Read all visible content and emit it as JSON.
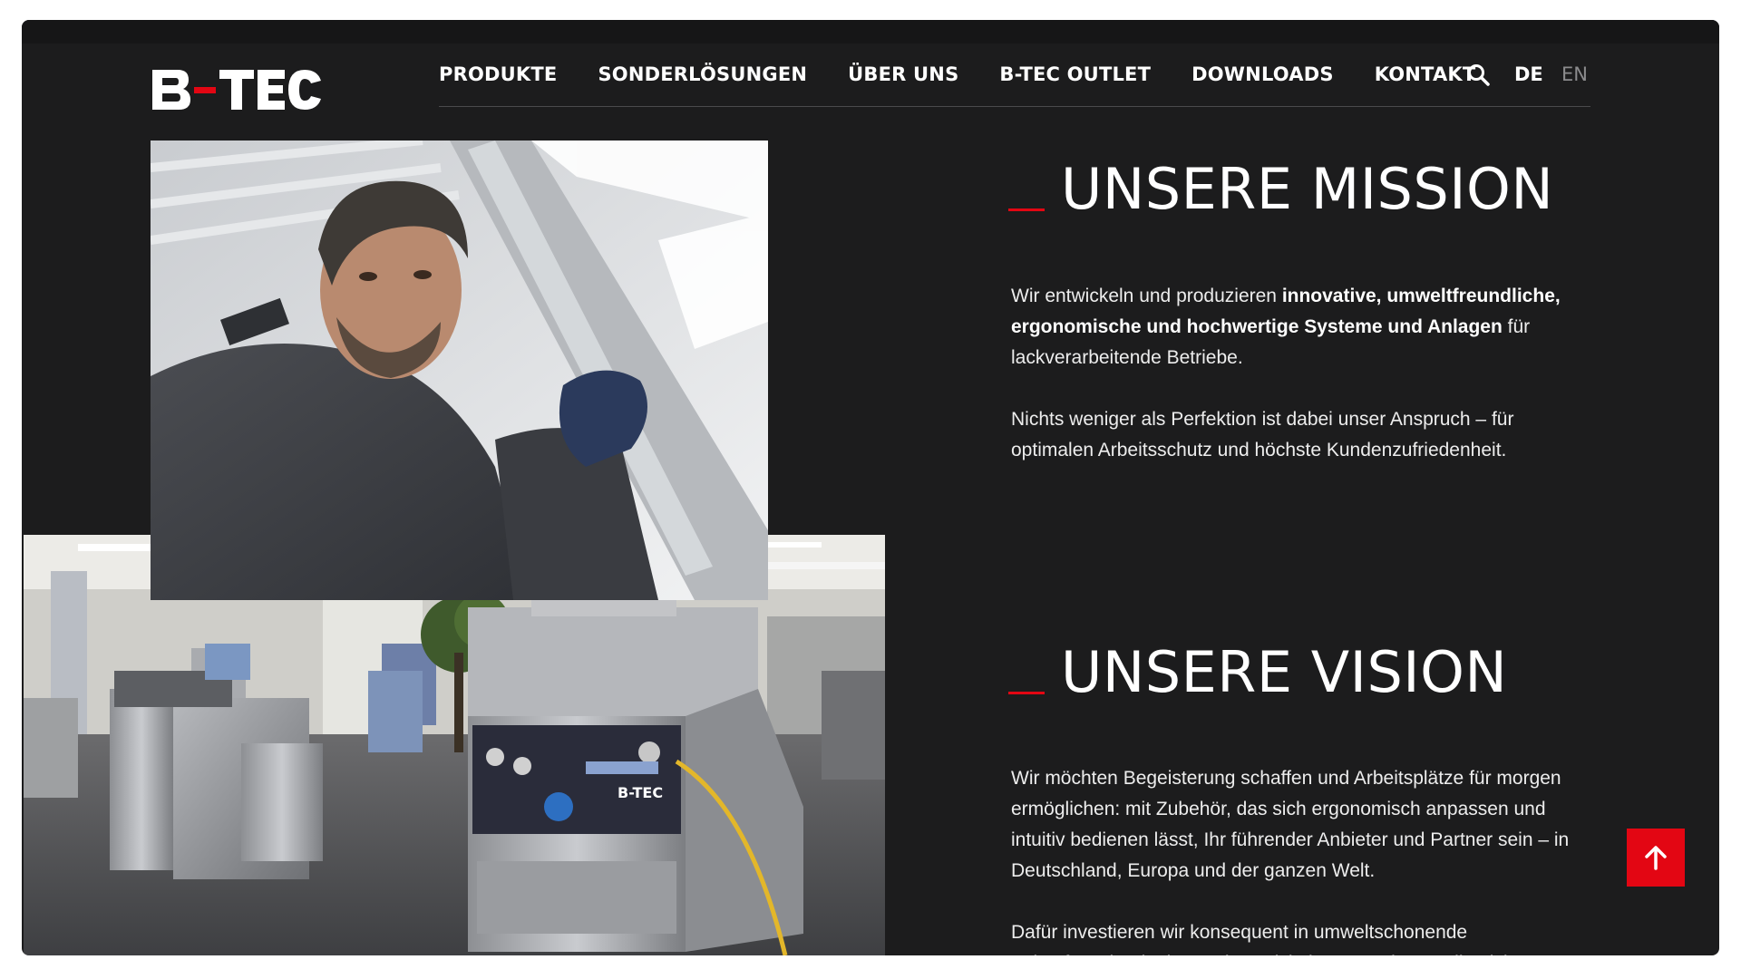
{
  "brand": {
    "logo_text": "B-TEC",
    "accent_color": "#e30613",
    "background": "#1c1c1d"
  },
  "nav": {
    "items": [
      {
        "label": "PRODUKTE"
      },
      {
        "label": "SONDERLÖSUNGEN"
      },
      {
        "label": "ÜBER UNS"
      },
      {
        "label": "B-TEC OUTLET"
      },
      {
        "label": "DOWNLOADS"
      },
      {
        "label": "KONTAKT"
      }
    ],
    "search_icon": "search-icon",
    "languages": {
      "active": "DE",
      "other": "EN"
    }
  },
  "images": {
    "top": "worker-holding-glass-panel-photo",
    "bottom": "cleaning-machines-showroom-photo",
    "machine_brand_plate": "B-TEC"
  },
  "mission": {
    "title": "UNSERE MISSION",
    "p1_pre": "Wir entwickeln und produzieren ",
    "p1_bold": "innovative, umweltfreundliche, ergonomische und hochwertige Systeme und Anlagen",
    "p1_post": " für lackverarbeitende Betriebe.",
    "p2": "Nichts weniger als Perfektion ist dabei unser Anspruch – für optimalen Arbeitsschutz und höchste Kundenzufriedenheit."
  },
  "vision": {
    "title": "UNSERE VISION",
    "p1": "Wir möchten Begeisterung schaffen und Arbeitsplätze für morgen ermöglichen: mit Zubehör, das sich ergonomisch anpassen und intuitiv bedienen lässt, Ihr führender Anbieter und Partner sein – in Deutschland, Europa und der ganzen Welt.",
    "p2": "Dafür investieren wir konsequent in umweltschonende Zukunftstechnologien und entwickeln Innovationen, die nicht nur"
  },
  "scroll_top": {
    "icon": "arrow-up-icon"
  }
}
